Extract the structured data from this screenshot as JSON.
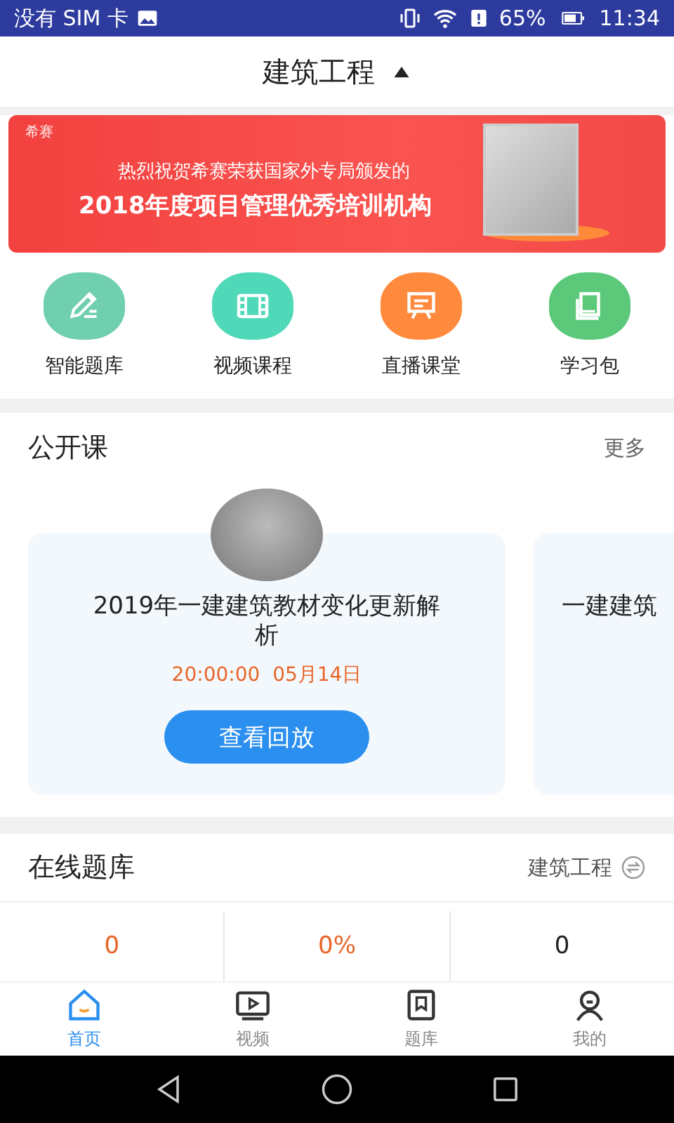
{
  "status_bar": {
    "carrier": "没有 SIM 卡",
    "battery": "65%",
    "time": "11:34"
  },
  "header": {
    "title": "建筑工程",
    "expanded": true
  },
  "banner": {
    "brand": "希赛",
    "line_1": "热烈祝贺希赛荣获国家外专局颁发的",
    "line_2": "2018年度项目管理优秀培训机构"
  },
  "quick_menu": [
    {
      "label": "智能题库",
      "kind": "pencil",
      "color": "#6fcfae"
    },
    {
      "label": "视频课程",
      "kind": "film",
      "color": "#4fd9b8"
    },
    {
      "label": "直播课堂",
      "kind": "board",
      "color": "#ff8a3d"
    },
    {
      "label": "学习包",
      "kind": "book",
      "color": "#5cc97a"
    }
  ],
  "open_courses": {
    "title": "公开课",
    "more": "更多",
    "cards": [
      {
        "title": "2019年一建建筑教材变化更新解析",
        "time": "20:00:00  05月14日",
        "button": "查看回放"
      },
      {
        "title": "一建建筑"
      }
    ]
  },
  "question_bank": {
    "title": "在线题库",
    "subject": "建筑工程",
    "stats": [
      {
        "value": "0",
        "color": "#e8672a"
      },
      {
        "value": "0%",
        "color": "#e8672a"
      },
      {
        "value": "0",
        "color": "#222222"
      }
    ]
  },
  "tab_bar": [
    {
      "label": "首页",
      "kind": "home",
      "selected": true
    },
    {
      "label": "视频",
      "kind": "video",
      "selected": false
    },
    {
      "label": "题库",
      "kind": "bank",
      "selected": false
    },
    {
      "label": "我的",
      "kind": "profile",
      "selected": false
    }
  ]
}
